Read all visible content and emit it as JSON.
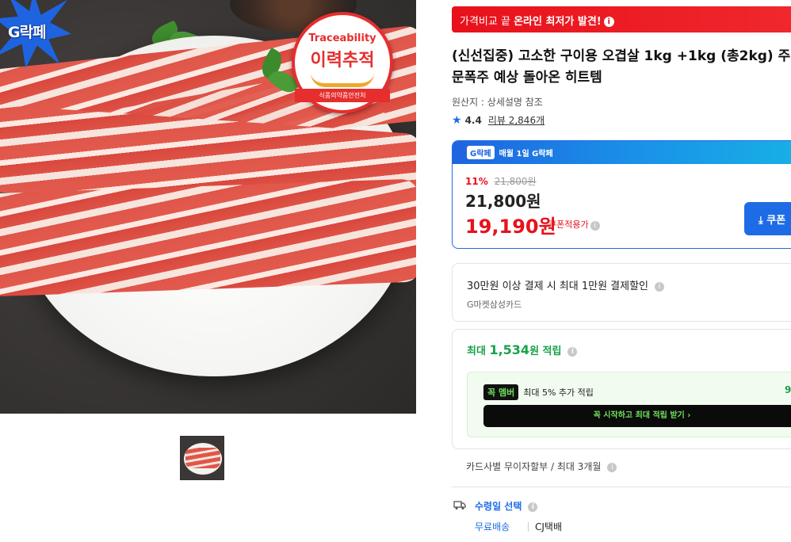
{
  "gallery": {
    "badge_text": "G락페",
    "trace_en": "Traceability",
    "trace_ko": "이력추적",
    "trace_org": "식품의약품안전처"
  },
  "compare_banner": {
    "prefix": "가격비교 끝 ",
    "bold": "온라인 최저가 발견!",
    "icon": "info-icon"
  },
  "product": {
    "title": "(신선집중) 고소한 구이용 오겹살 1kg +1kg (총2kg) 주문폭주 예상 돌아온 히트템",
    "origin": "원산지 : 상세설명 참조",
    "rating": "4.4",
    "review_label": "리뷰 2,846개"
  },
  "price": {
    "header_logo": "G락페",
    "header_text": "매월 1일 G락페",
    "discount_rate": "11%",
    "original_price": "21,800원",
    "sale_price": "21,800원",
    "coupon_price": "19,190원",
    "coupon_label": "쿠폰적용가",
    "coupon_button": "쿠폰"
  },
  "card_offer": {
    "title": "30만원 이상 결제 시 최대 1만원 결제할인",
    "subtitle": "G마켓삼성카드"
  },
  "reward": {
    "prefix": "최대 ",
    "amount": "1,534",
    "suffix": "원 적립",
    "member_badge": "꼭 멤버",
    "member_text": "최대 5% 추가 적립",
    "member_extra": "9",
    "member_button": "꼭 시작하고 최대 적립 받기 ›"
  },
  "installment": {
    "text": "카드사별 무이자할부 / 최대 3개월"
  },
  "delivery": {
    "label": "수령일 선택",
    "free": "무료배송",
    "courier": "CJ택배"
  },
  "colors": {
    "brand_red": "#e8111b",
    "brand_blue": "#1e6be6",
    "reward_green": "#16a34a"
  }
}
